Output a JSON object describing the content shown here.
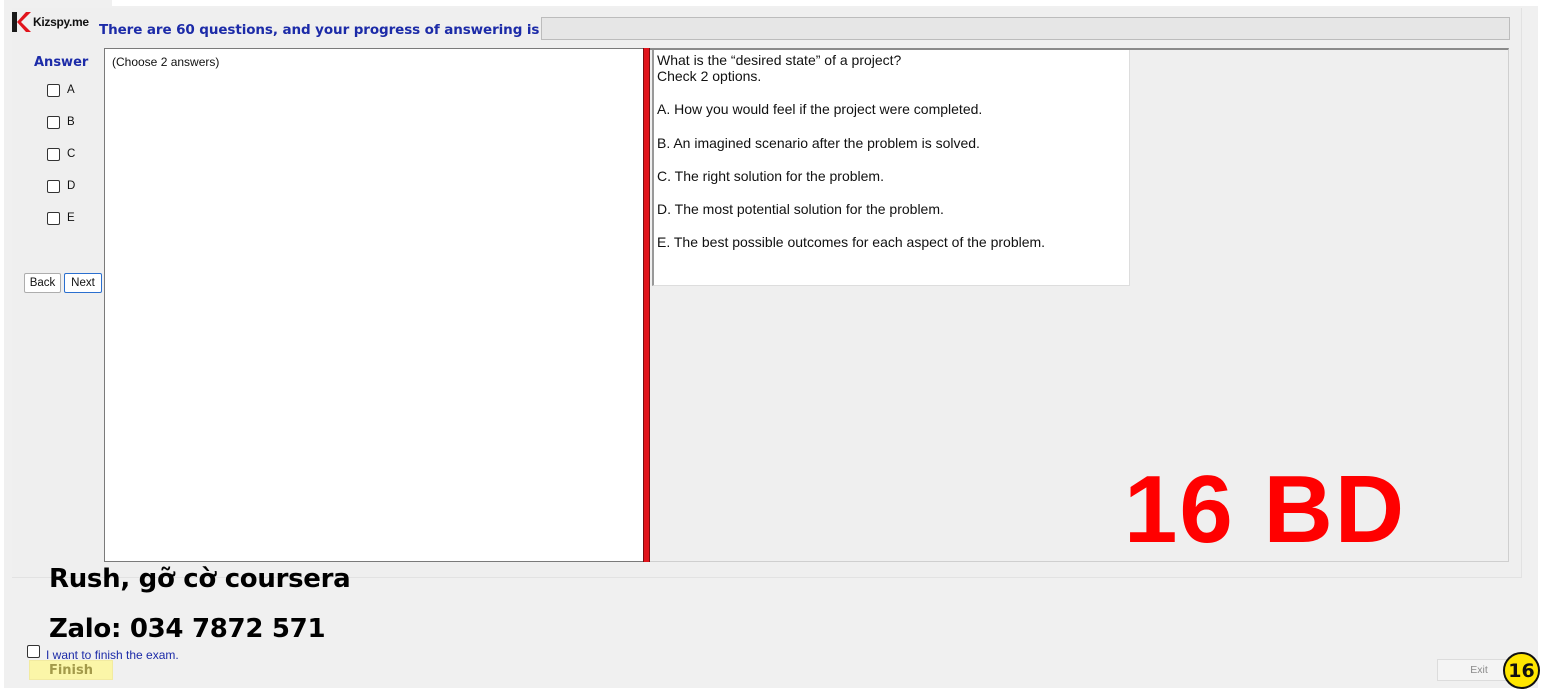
{
  "app": {
    "logo_text": "Kizspy.me",
    "progress_text": "There are 60 questions, and your progress of answering is",
    "progress_fraction": 0
  },
  "answer_panel": {
    "title": "Answer",
    "options": [
      "A",
      "B",
      "C",
      "D",
      "E"
    ],
    "back_label": "Back",
    "next_label": "Next"
  },
  "left_panel": {
    "instruction": "(Choose 2 answers)"
  },
  "question": {
    "lines": [
      "What is the “desired state” of a project?",
      "Check 2 options.",
      "A.  How you would feel if the project were completed.",
      "B.  An imagined scenario after the problem is solved.",
      "C.  The right solution for the problem.",
      "D.  The most potential solution for the problem.",
      "E.  The best possible outcomes for each aspect of the problem."
    ]
  },
  "overlay": {
    "code": "16 BD",
    "watermark_line1": "Rush, gỡ cờ coursera",
    "watermark_line2": "Zalo: 034 7872 571",
    "badge": "16"
  },
  "footer": {
    "finish_checkbox_label": "I want to finish the exam.",
    "finish_label": "Finish",
    "exit_label": "Exit"
  },
  "colors": {
    "title_blue": "#1c2ba8",
    "splitter_red": "#e1141c",
    "code_red": "#ff0000",
    "badge_yellow": "#ffe600",
    "finish_yellow": "#fbf6a8"
  }
}
